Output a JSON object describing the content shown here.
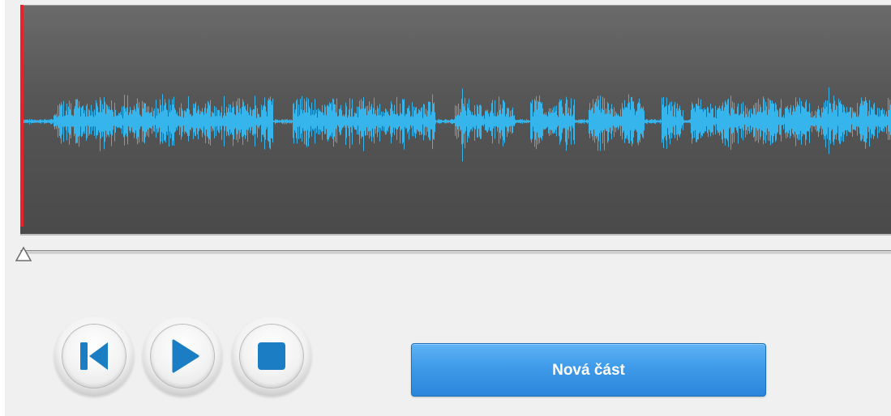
{
  "colors": {
    "waveform_background": "#4f4f4f",
    "waveform_signal": "#36b4ec",
    "playhead": "#e8222a",
    "panel_background": "#f0f0f0",
    "primary_button": "#3f9ae8",
    "control_icon": "#1b7ec4"
  },
  "waveform": {
    "icon": "audio-waveform",
    "playhead_position": 0
  },
  "timeline": {
    "position": 0,
    "icon": "triangle-up-slider-thumb"
  },
  "controls": {
    "rewind": {
      "icon": "skip-to-start-icon"
    },
    "play": {
      "icon": "play-icon"
    },
    "stop": {
      "icon": "stop-icon"
    }
  },
  "actions": {
    "new_part_label": "Nová část"
  }
}
